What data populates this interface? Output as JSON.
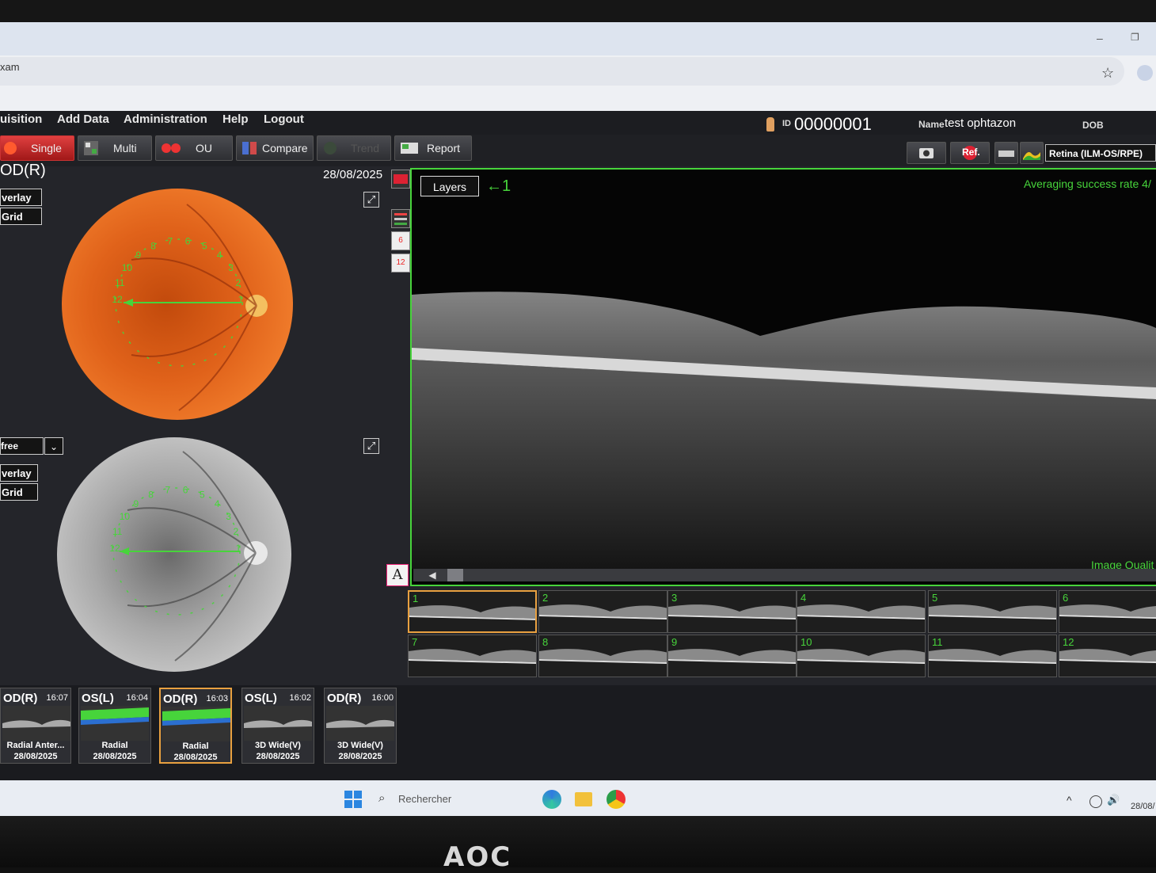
{
  "browser": {
    "address_partial": "xam",
    "minimize": "–",
    "maximize": "❐",
    "star": "☆"
  },
  "menu": {
    "items": [
      "uisition",
      "Add Data",
      "Administration",
      "Help",
      "Logout"
    ]
  },
  "patient": {
    "id_label": "ID",
    "id_value": "00000001",
    "name_label": "Name",
    "name_value": "test ophtazon",
    "dob_label": "DOB"
  },
  "toolbar": {
    "single": "Single",
    "multi": "Multi",
    "ou": "OU",
    "compare": "Compare",
    "trend": "Trend",
    "report": "Report",
    "ref_label": "Ref.",
    "layer_select": "Retina (ILM-OS/RPE)"
  },
  "left": {
    "eye": "OD(R)",
    "date": "28/08/2025",
    "overlay": "verlay",
    "grid": "Grid",
    "redfree": "free",
    "dropdown": "⌄",
    "expand": "⤢",
    "text_tool": "A",
    "side_tool_6": "6",
    "side_tool_12": "12",
    "radial_numbers": [
      "1",
      "2",
      "3",
      "4",
      "5",
      "6",
      "7",
      "8",
      "9",
      "10",
      "11",
      "12"
    ]
  },
  "oct": {
    "layers": "Layers",
    "arrow_label": "←1",
    "averaging": "Averaging success rate 4/",
    "image_quality": "Image Qualit",
    "scroll_left": "◀"
  },
  "thumbs": [
    "1",
    "2",
    "3",
    "4",
    "5",
    "6",
    "7",
    "8",
    "9",
    "10",
    "11",
    "12"
  ],
  "history": [
    {
      "eye": "OD(R)",
      "time": "16:07",
      "scan": "Radial Anter...",
      "date": "28/08/2025"
    },
    {
      "eye": "OS(L)",
      "time": "16:04",
      "scan": "Radial",
      "date": "28/08/2025"
    },
    {
      "eye": "OD(R)",
      "time": "16:03",
      "scan": "Radial",
      "date": "28/08/2025"
    },
    {
      "eye": "OS(L)",
      "time": "16:02",
      "scan": "3D Wide(V)",
      "date": "28/08/2025"
    },
    {
      "eye": "OD(R)",
      "time": "16:00",
      "scan": "3D Wide(V)",
      "date": "28/08/2025"
    }
  ],
  "taskbar": {
    "search": "Rechercher",
    "search_glyph": "⌕",
    "chevron": "^",
    "volume": "🔊",
    "date": "28/08/"
  },
  "monitor": {
    "brand": "AOC"
  }
}
